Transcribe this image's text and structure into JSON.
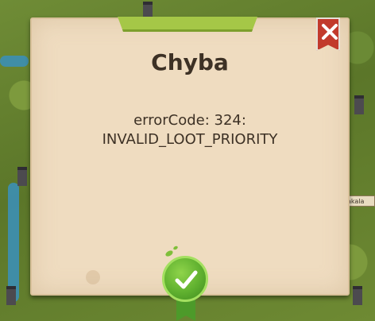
{
  "dialog": {
    "title": "Chyba",
    "message_line1": "errorCode: 324:",
    "message_line2": "INVALID_LOOT_PRIORITY"
  },
  "map": {
    "sign_label": "akala"
  },
  "icons": {
    "close": "close-icon",
    "confirm": "checkmark-icon"
  },
  "colors": {
    "dialog_bg": "#efdcc0",
    "title_text": "#3d3125",
    "close_red": "#c23a2c",
    "ok_green": "#5fb02f",
    "header_tab_green": "#a5c747"
  }
}
